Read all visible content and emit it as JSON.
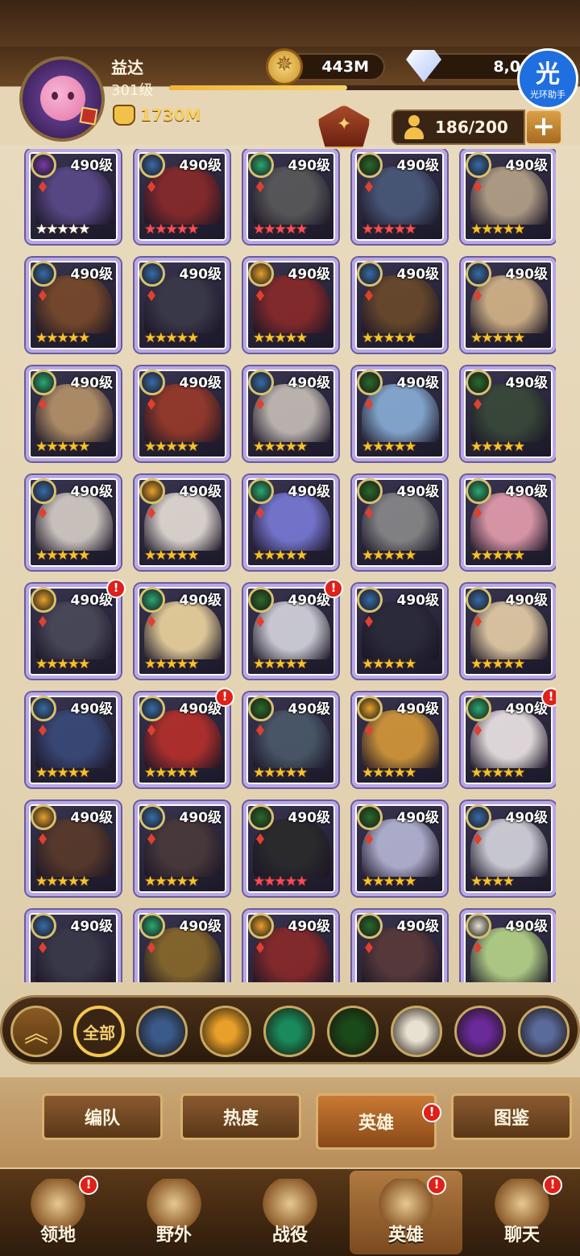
{
  "player": {
    "name": "益达",
    "level": "301级",
    "power": "1730M",
    "xp_fraction": 0.47
  },
  "resources": {
    "gold": "443M",
    "diamonds": "8,0"
  },
  "assistant": {
    "glyph": "光",
    "label": "光环助手"
  },
  "roster": {
    "count": "186/200",
    "add": "+"
  },
  "heroes": [
    {
      "level": "490级",
      "faction": "purple",
      "stars": "★★★★★",
      "star_color": "white",
      "color": "#5b4a8a",
      "alert": false
    },
    {
      "level": "490级",
      "faction": "blue",
      "stars": "★★★★★",
      "star_color": "red",
      "color": "#8a2a2a",
      "alert": false
    },
    {
      "level": "490级",
      "faction": "green",
      "stars": "★★★★★",
      "star_color": "red",
      "color": "#5a5a5a",
      "alert": false
    },
    {
      "level": "490级",
      "faction": "darkgreen",
      "stars": "★★★★★",
      "star_color": "red",
      "color": "#4a5a7a",
      "alert": false
    },
    {
      "level": "490级",
      "faction": "blue",
      "stars": "★★★★★",
      "star_color": "gold",
      "color": "#b8a48a",
      "alert": false
    },
    {
      "level": "490级",
      "faction": "blue",
      "stars": "★★★★★",
      "star_color": "gold",
      "color": "#7a4a2a",
      "alert": false
    },
    {
      "level": "490级",
      "faction": "blue",
      "stars": "★★★★★",
      "star_color": "gold",
      "color": "#3a3a4a",
      "alert": false
    },
    {
      "level": "490级",
      "faction": "orange",
      "stars": "★★★★★",
      "star_color": "gold",
      "color": "#8a2a2a",
      "alert": false
    },
    {
      "level": "490级",
      "faction": "blue",
      "stars": "★★★★★",
      "star_color": "gold",
      "color": "#6a4a2a",
      "alert": false
    },
    {
      "level": "490级",
      "faction": "blue",
      "stars": "★★★★★",
      "star_color": "gold",
      "color": "#d8b88a",
      "alert": false
    },
    {
      "level": "490级",
      "faction": "green",
      "stars": "★★★★★",
      "star_color": "gold",
      "color": "#b8946a",
      "alert": false
    },
    {
      "level": "490级",
      "faction": "blue",
      "stars": "★★★★★",
      "star_color": "gold",
      "color": "#9a3a2a",
      "alert": false
    },
    {
      "level": "490级",
      "faction": "blue",
      "stars": "★★★★★",
      "star_color": "gold",
      "color": "#c8c0b8",
      "alert": false
    },
    {
      "level": "490级",
      "faction": "darkgreen",
      "stars": "★★★★★",
      "star_color": "gold",
      "color": "#8ab0d8",
      "alert": false
    },
    {
      "level": "490级",
      "faction": "darkgreen",
      "stars": "★★★★★",
      "star_color": "gold",
      "color": "#3a4a3a",
      "alert": false
    },
    {
      "level": "490级",
      "faction": "blue",
      "stars": "★★★★★",
      "star_color": "gold",
      "color": "#d8d0c8",
      "alert": false
    },
    {
      "level": "490级",
      "faction": "orange",
      "stars": "★★★★★",
      "star_color": "gold",
      "color": "#e8e0d8",
      "alert": false
    },
    {
      "level": "490级",
      "faction": "green",
      "stars": "★★★★★",
      "star_color": "gold",
      "color": "#7a7ad8",
      "alert": false
    },
    {
      "level": "490级",
      "faction": "darkgreen",
      "stars": "★★★★★",
      "star_color": "gold",
      "color": "#8a8a8a",
      "alert": false
    },
    {
      "level": "490级",
      "faction": "green",
      "stars": "★★★★★",
      "star_color": "gold",
      "color": "#e8a0b0",
      "alert": false
    },
    {
      "level": "490级",
      "faction": "orange",
      "stars": "★★★★★",
      "star_color": "gold",
      "color": "#4a4a5a",
      "alert": true
    },
    {
      "level": "490级",
      "faction": "green",
      "stars": "★★★★★",
      "star_color": "gold",
      "color": "#f0d8a0",
      "alert": false
    },
    {
      "level": "490级",
      "faction": "darkgreen",
      "stars": "★★★★★",
      "star_color": "gold",
      "color": "#d8d8e0",
      "alert": true
    },
    {
      "level": "490级",
      "faction": "blue",
      "stars": "★★★★★",
      "star_color": "gold",
      "color": "#2a2a3a",
      "alert": false
    },
    {
      "level": "490级",
      "faction": "blue",
      "stars": "★★★★★",
      "star_color": "gold",
      "color": "#e8d0a8",
      "alert": false
    },
    {
      "level": "490级",
      "faction": "blue",
      "stars": "★★★★★",
      "star_color": "gold",
      "color": "#3a4a7a",
      "alert": false
    },
    {
      "level": "490级",
      "faction": "blue",
      "stars": "★★★★★",
      "star_color": "gold",
      "color": "#b8302a",
      "alert": true
    },
    {
      "level": "490级",
      "faction": "darkgreen",
      "stars": "★★★★★",
      "star_color": "gold",
      "color": "#4a5a6a",
      "alert": false
    },
    {
      "level": "490级",
      "faction": "orange",
      "stars": "★★★★★",
      "star_color": "gold",
      "color": "#d89a3a",
      "alert": false
    },
    {
      "level": "490级",
      "faction": "green",
      "stars": "★★★★★",
      "star_color": "gold",
      "color": "#f0e8e8",
      "alert": true
    },
    {
      "level": "490级",
      "faction": "orange",
      "stars": "★★★★★",
      "star_color": "gold",
      "color": "#5a3a2a",
      "alert": false
    },
    {
      "level": "490级",
      "faction": "blue",
      "stars": "★★★★★",
      "star_color": "gold",
      "color": "#4a3a3a",
      "alert": false
    },
    {
      "level": "490级",
      "faction": "darkgreen",
      "stars": "★★★★★",
      "star_color": "red",
      "color": "#2a2a2a",
      "alert": false
    },
    {
      "level": "490级",
      "faction": "darkgreen",
      "stars": "★★★★★",
      "star_color": "gold",
      "color": "#b8b8d8",
      "alert": false
    },
    {
      "level": "490级",
      "faction": "blue",
      "stars": "★★★★",
      "star_color": "gold",
      "color": "#d8d8e0",
      "alert": false
    },
    {
      "level": "490级",
      "faction": "blue",
      "stars": "",
      "star_color": "gold",
      "color": "#3a3a4a",
      "alert": false
    },
    {
      "level": "490级",
      "faction": "green",
      "stars": "",
      "star_color": "gold",
      "color": "#8a6a2a",
      "alert": false
    },
    {
      "level": "490级",
      "faction": "orange",
      "stars": "",
      "star_color": "gold",
      "color": "#8a2a2a",
      "alert": false
    },
    {
      "level": "490级",
      "faction": "darkgreen",
      "stars": "",
      "star_color": "gold",
      "color": "#5a3a3a",
      "alert": false
    },
    {
      "level": "490级",
      "faction": "white",
      "stars": "",
      "star_color": "gold",
      "color": "#b8d88a",
      "alert": false
    }
  ],
  "faction_colors": {
    "purple": "#7a3aa8",
    "blue": "#3a6aa8",
    "green": "#2aa870",
    "darkgreen": "#2a6a2a",
    "orange": "#e8a02a",
    "white": "#e8e0d0"
  },
  "filters": {
    "all_label": "全部",
    "icons": [
      "star-compass-icon",
      "sun-icon",
      "leaf-icon",
      "eye-icon",
      "light-star-icon",
      "dark-gem-icon",
      "shield-rune-icon"
    ],
    "colors": [
      "#3a5a8a",
      "#e8a02a",
      "#1a8a5a",
      "#1a4a1a",
      "#e8e0d0",
      "#6a2a9a",
      "#5a6a9a"
    ]
  },
  "tabs": [
    {
      "label": "编队"
    },
    {
      "label": "热度"
    },
    {
      "label": "英雄",
      "active": true,
      "alert": "!"
    },
    {
      "label": "图鉴"
    }
  ],
  "nav": [
    {
      "label": "领地",
      "icon": "castle-icon",
      "alert": "!"
    },
    {
      "label": "野外",
      "icon": "map-scroll-icon",
      "alert": ""
    },
    {
      "label": "战役",
      "icon": "sword-emblem-icon",
      "alert": ""
    },
    {
      "label": "英雄",
      "icon": "helmet-icon",
      "alert": "!",
      "active": true
    },
    {
      "label": "聊天",
      "icon": "chat-bubble-icon",
      "alert": "!"
    }
  ]
}
